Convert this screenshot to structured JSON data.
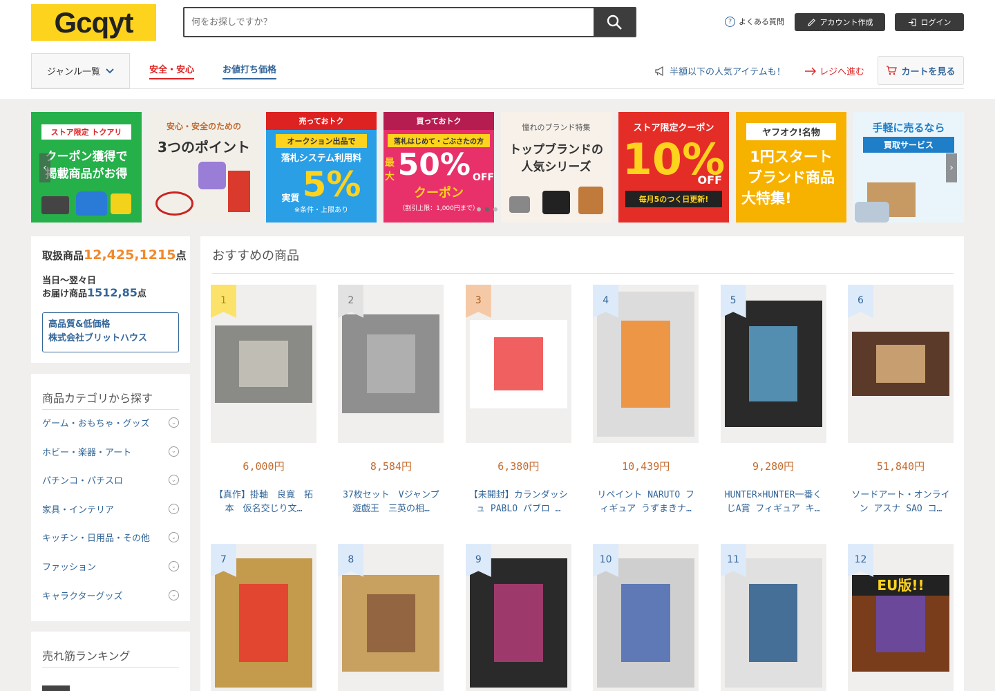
{
  "header": {
    "logo": "Gcqyt",
    "search_placeholder": "何をお探しですか？",
    "faq": "よくある質問",
    "create_account": "アカウント作成",
    "login": "ログイン",
    "genre": "ジャンル一覧",
    "tab_safe": "安全・安心",
    "tab_price": "お値打ち価格",
    "promo": "半額以下の人気アイテムも！",
    "regi": "レジへ進む",
    "cart": "カートを見る"
  },
  "banners": [
    {
      "line1": "ストア限定 トクアリ",
      "line2": "クーポン獲得で",
      "line3": "掲載商品がお得"
    },
    {
      "line1": "安心・安全のための",
      "line2": "3つのポイント",
      "line3": ""
    },
    {
      "line1": "売っておトク",
      "line2": "オークション出品で",
      "line3": "落札システム利用料",
      "line4": "実質",
      "big": "5%",
      "line5": "※条件・上限あり"
    },
    {
      "line1": "買っておトク",
      "line2": "落札はじめて・ごぶさたの方",
      "line3": "最大",
      "big": "50%",
      "line4": "OFF",
      "line5": "クーポン",
      "line6": "（割引上限：1,000円まで）"
    },
    {
      "line1": "憧れのブランド特集",
      "line2": "トップブランドの",
      "line3": "人気シリーズ"
    },
    {
      "line1": "ストア限定クーポン",
      "big": "10%",
      "line2": "OFF",
      "line3": "毎月5のつく日更新!"
    },
    {
      "line1": "ヤフオク!名物",
      "line2": "1円スタート",
      "line3": "ブランド商品",
      "line4": "大特集!"
    },
    {
      "line1": "手軽に売るなら",
      "line2": "買取サービス"
    }
  ],
  "sidebar": {
    "count_label": "取扱商品",
    "count_value": "12,425,1215",
    "count_unit": "点",
    "delivery_line1": "当日〜翌々日",
    "delivery_label": "お届け商品",
    "delivery_value": "1512,85",
    "delivery_unit": "点",
    "company_line1": "高品質&低価格",
    "company_line2": "株式会社ブリットハウス",
    "category_title": "商品カテゴリから探す",
    "categories": [
      "ゲーム・おもちゃ・グッズ",
      "ホビー・楽器・アート",
      "パチンコ・パチスロ",
      "家具・インテリア",
      "キッチン・日用品・その他",
      "ファッション",
      "キャラクターグッズ"
    ],
    "ranking_title": "売れ筋ランキング"
  },
  "main": {
    "title": "おすすめの商品",
    "products": [
      {
        "rank": "1",
        "price": "6,000円",
        "name": "【真作】掛軸　良寛　拓本　仮名交じり文…"
      },
      {
        "rank": "2",
        "price": "8,584円",
        "name": "37枚セット　Vジャンプ　遊戯王　三英の相…"
      },
      {
        "rank": "3",
        "price": "6,380円",
        "name": "【未開封】カランダッシュ PABLO パブロ …"
      },
      {
        "rank": "4",
        "price": "10,439円",
        "name": "リペイント NARUTO フィギュア うずまきナ…"
      },
      {
        "rank": "5",
        "price": "9,280円",
        "name": "HUNTER×HUNTER一番くじA賞 フィギュア キ…"
      },
      {
        "rank": "6",
        "price": "51,840円",
        "name": "ソードアート・オンライン アスナ SAO コ…"
      },
      {
        "rank": "7",
        "price": "",
        "name": ""
      },
      {
        "rank": "8",
        "price": "",
        "name": ""
      },
      {
        "rank": "9",
        "price": "",
        "name": ""
      },
      {
        "rank": "10",
        "price": "",
        "name": ""
      },
      {
        "rank": "11",
        "price": "",
        "name": ""
      },
      {
        "rank": "12",
        "price": "",
        "name": ""
      }
    ],
    "card12_text": "EU版!!"
  },
  "colors": {
    "brand_yellow": "#fdd31d",
    "link_blue": "#336699",
    "price_orange": "#c36a2d",
    "accent_red": "#d22",
    "accent_orange": "#f08a2c"
  }
}
